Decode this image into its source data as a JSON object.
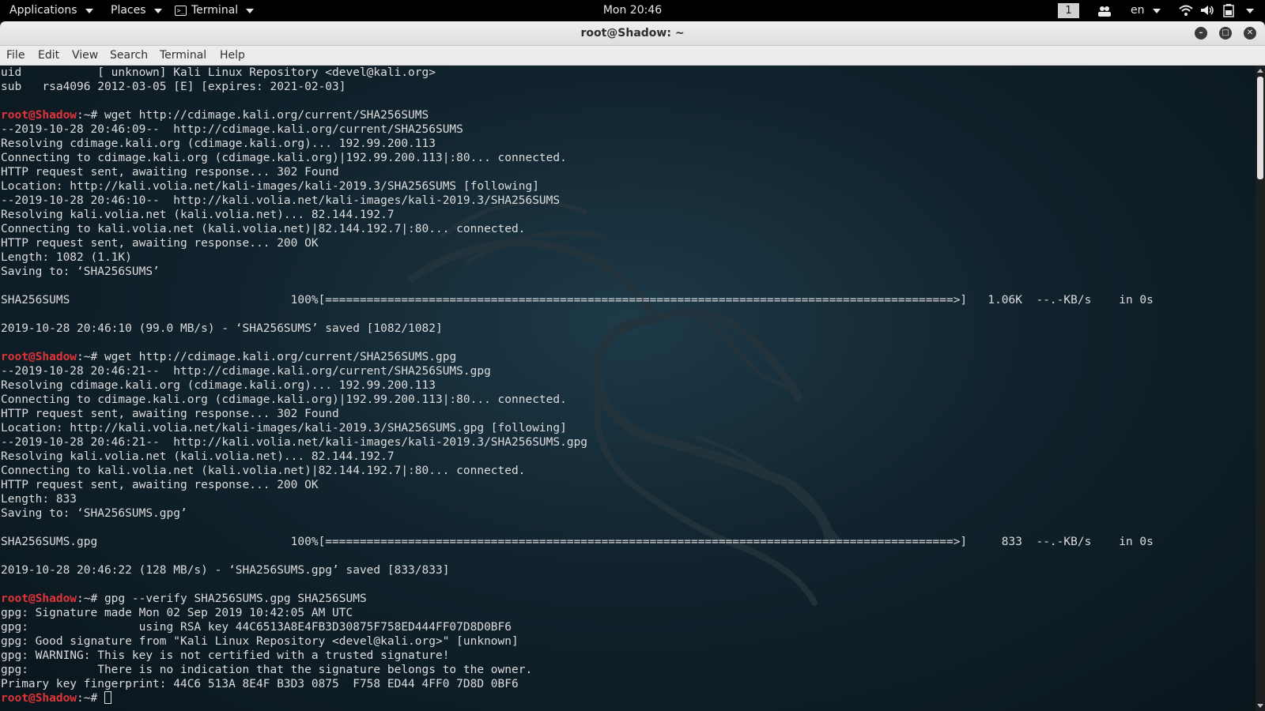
{
  "top_panel": {
    "applications": "Applications",
    "places": "Places",
    "terminal": "Terminal",
    "clock": "Mon 20:46",
    "workspace": "1",
    "language": "en"
  },
  "window": {
    "title": "root@Shadow: ~"
  },
  "menu": [
    "File",
    "Edit",
    "View",
    "Search",
    "Terminal",
    "Help"
  ],
  "terminal": {
    "prompt_user": "root@Shadow",
    "prompt_suffix": ":~# ",
    "lines": [
      {
        "t": "uid           [ unknown] Kali Linux Repository <devel@kali.org>"
      },
      {
        "t": "sub   rsa4096 2012-03-05 [E] [expires: 2021-02-03]"
      },
      {
        "t": ""
      },
      {
        "p": true,
        "t": "wget http://cdimage.kali.org/current/SHA256SUMS"
      },
      {
        "t": "--2019-10-28 20:46:09--  http://cdimage.kali.org/current/SHA256SUMS"
      },
      {
        "t": "Resolving cdimage.kali.org (cdimage.kali.org)... 192.99.200.113"
      },
      {
        "t": "Connecting to cdimage.kali.org (cdimage.kali.org)|192.99.200.113|:80... connected."
      },
      {
        "t": "HTTP request sent, awaiting response... 302 Found"
      },
      {
        "t": "Location: http://kali.volia.net/kali-images/kali-2019.3/SHA256SUMS [following]"
      },
      {
        "t": "--2019-10-28 20:46:10--  http://kali.volia.net/kali-images/kali-2019.3/SHA256SUMS"
      },
      {
        "t": "Resolving kali.volia.net (kali.volia.net)... 82.144.192.7"
      },
      {
        "t": "Connecting to kali.volia.net (kali.volia.net)|82.144.192.7|:80... connected."
      },
      {
        "t": "HTTP request sent, awaiting response... 200 OK"
      },
      {
        "t": "Length: 1082 (1.1K)"
      },
      {
        "t": "Saving to: ‘SHA256SUMS’"
      },
      {
        "t": ""
      },
      {
        "t": "SHA256SUMS                                100%[===========================================================================================>]   1.06K  --.-KB/s    in 0s"
      },
      {
        "t": ""
      },
      {
        "t": "2019-10-28 20:46:10 (99.0 MB/s) - ‘SHA256SUMS’ saved [1082/1082]"
      },
      {
        "t": ""
      },
      {
        "p": true,
        "t": "wget http://cdimage.kali.org/current/SHA256SUMS.gpg"
      },
      {
        "t": "--2019-10-28 20:46:21--  http://cdimage.kali.org/current/SHA256SUMS.gpg"
      },
      {
        "t": "Resolving cdimage.kali.org (cdimage.kali.org)... 192.99.200.113"
      },
      {
        "t": "Connecting to cdimage.kali.org (cdimage.kali.org)|192.99.200.113|:80... connected."
      },
      {
        "t": "HTTP request sent, awaiting response... 302 Found"
      },
      {
        "t": "Location: http://kali.volia.net/kali-images/kali-2019.3/SHA256SUMS.gpg [following]"
      },
      {
        "t": "--2019-10-28 20:46:21--  http://kali.volia.net/kali-images/kali-2019.3/SHA256SUMS.gpg"
      },
      {
        "t": "Resolving kali.volia.net (kali.volia.net)... 82.144.192.7"
      },
      {
        "t": "Connecting to kali.volia.net (kali.volia.net)|82.144.192.7|:80... connected."
      },
      {
        "t": "HTTP request sent, awaiting response... 200 OK"
      },
      {
        "t": "Length: 833"
      },
      {
        "t": "Saving to: ‘SHA256SUMS.gpg’"
      },
      {
        "t": ""
      },
      {
        "t": "SHA256SUMS.gpg                            100%[===========================================================================================>]     833  --.-KB/s    in 0s"
      },
      {
        "t": ""
      },
      {
        "t": "2019-10-28 20:46:22 (128 MB/s) - ‘SHA256SUMS.gpg’ saved [833/833]"
      },
      {
        "t": ""
      },
      {
        "p": true,
        "t": "gpg --verify SHA256SUMS.gpg SHA256SUMS"
      },
      {
        "t": "gpg: Signature made Mon 02 Sep 2019 10:42:05 AM UTC"
      },
      {
        "t": "gpg:                using RSA key 44C6513A8E4FB3D30875F758ED444FF07D8D0BF6"
      },
      {
        "t": "gpg: Good signature from \"Kali Linux Repository <devel@kali.org>\" [unknown]"
      },
      {
        "t": "gpg: WARNING: This key is not certified with a trusted signature!"
      },
      {
        "t": "gpg:          There is no indication that the signature belongs to the owner."
      },
      {
        "t": "Primary key fingerprint: 44C6 513A 8E4F B3D3 0875  F758 ED44 4FF0 7D8D 0BF6"
      },
      {
        "p": true,
        "t": "",
        "cursor": true
      }
    ]
  },
  "colors": {
    "prompt": "#e0343a",
    "terminal_bg": "#11232d",
    "panel_bg": "#000000"
  },
  "icons": [
    "terminal-icon",
    "people-icon",
    "wifi-icon",
    "volume-icon",
    "battery-icon",
    "minimize-icon",
    "maximize-icon",
    "close-icon",
    "kali-dragon-icon"
  ]
}
